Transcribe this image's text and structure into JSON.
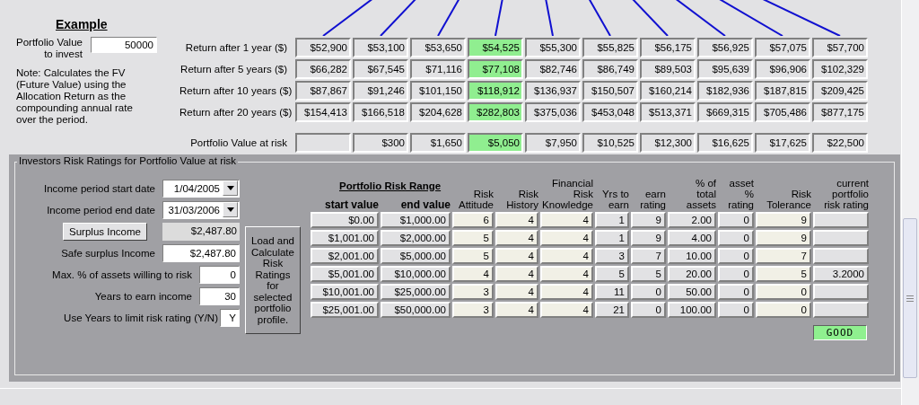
{
  "example": {
    "title": "Example",
    "value_label": "Portfolio Value\nto invest",
    "value": "50000",
    "note": "Note: Calculates the FV (Future Value) using the Allocation Return as the compounding annual rate over the period."
  },
  "allocations": [
    {
      "selected": false
    },
    {
      "selected": false
    },
    {
      "selected": false
    },
    {
      "selected": true
    },
    {
      "selected": false
    },
    {
      "selected": false
    },
    {
      "selected": false
    },
    {
      "selected": false
    },
    {
      "selected": false
    },
    {
      "selected": false
    }
  ],
  "returns": [
    {
      "label": "Return after 1 year ($)",
      "values": [
        "$52,900",
        "$53,100",
        "$53,650",
        "$54,525",
        "$55,300",
        "$55,825",
        "$56,175",
        "$56,925",
        "$57,075",
        "$57,700"
      ]
    },
    {
      "label": "Return after 5 years ($)",
      "values": [
        "$66,282",
        "$67,545",
        "$71,116",
        "$77,108",
        "$82,746",
        "$86,749",
        "$89,503",
        "$95,639",
        "$96,906",
        "$102,329"
      ]
    },
    {
      "label": "Return after 10 years ($)",
      "values": [
        "$87,867",
        "$91,246",
        "$101,150",
        "$118,912",
        "$136,937",
        "$150,507",
        "$160,214",
        "$182,936",
        "$187,815",
        "$209,425"
      ]
    },
    {
      "label": "Return after 20 years ($)",
      "values": [
        "$154,413",
        "$166,518",
        "$204,628",
        "$282,803",
        "$375,036",
        "$453,048",
        "$513,371",
        "$669,315",
        "$705,486",
        "$877,175"
      ]
    }
  ],
  "at_risk": {
    "label": "Portfolio Value at risk",
    "values": [
      "$300",
      "$1,650",
      "$5,050",
      "$7,950",
      "$10,525",
      "$12,300",
      "$16,625",
      "$17,625",
      "$22,500"
    ]
  },
  "risk_panel": {
    "title": "Investors Risk Ratings for Portfolio Value at risk",
    "fields": [
      {
        "kind": "dropdown",
        "label": "Income period start date",
        "value": "1/04/2005"
      },
      {
        "kind": "dropdown",
        "label": "Income period end date",
        "value": "31/03/2006"
      },
      {
        "kind": "action",
        "label": "Surplus Income",
        "value": "$2,487.80"
      },
      {
        "kind": "input",
        "label": "Safe surplus Income",
        "value": "$2,487.80"
      },
      {
        "kind": "number",
        "label": "Max. % of assets willing to risk",
        "value": "0"
      },
      {
        "kind": "number",
        "label": "Years to earn income",
        "value": "30"
      },
      {
        "kind": "flag",
        "label": "Use Years to limit risk rating (Y/N)",
        "value": "Y"
      }
    ],
    "load_button": "Load and Calculate Risk Ratings for selected portfolio profile.",
    "table_title": "Portfolio Risk Range",
    "columns": [
      {
        "kind": "range",
        "header": "start value"
      },
      {
        "kind": "range",
        "header": "end value"
      },
      {
        "kind": "input",
        "header": "Risk\nAttitude"
      },
      {
        "kind": "input",
        "header": "Risk\nHistory"
      },
      {
        "kind": "input",
        "header": "Financial\nRisk\nKnowledge"
      },
      {
        "kind": "calc",
        "header": "Yrs to\nearn"
      },
      {
        "kind": "calc",
        "header": "earn\nrating"
      },
      {
        "kind": "calc",
        "header": "% of\ntotal\nassets"
      },
      {
        "kind": "calc",
        "header": "asset\n%\nrating"
      },
      {
        "kind": "input",
        "header": "Risk\nTolerance"
      },
      {
        "kind": "calc",
        "header": "current\nportfolio\nrisk rating"
      }
    ],
    "rows": [
      [
        "$0.00",
        "$1,000.00",
        "6",
        "4",
        "4",
        "1",
        "9",
        "2.00",
        "0",
        "9"
      ],
      [
        "$1,001.00",
        "$2,000.00",
        "5",
        "4",
        "4",
        "1",
        "9",
        "4.00",
        "0",
        "9"
      ],
      [
        "$2,001.00",
        "$5,000.00",
        "5",
        "4",
        "4",
        "3",
        "7",
        "10.00",
        "0",
        "7"
      ],
      [
        "$5,001.00",
        "$10,000.00",
        "4",
        "4",
        "4",
        "5",
        "5",
        "20.00",
        "0",
        "5",
        "3.2000"
      ],
      [
        "$10,001.00",
        "$25,000.00",
        "3",
        "4",
        "4",
        "11",
        "0",
        "50.00",
        "0",
        "0"
      ],
      [
        "$25,001.00",
        "$50,000.00",
        "3",
        "4",
        "4",
        "21",
        "0",
        "100.00",
        "0",
        "0"
      ]
    ],
    "rating": "GOOD"
  }
}
